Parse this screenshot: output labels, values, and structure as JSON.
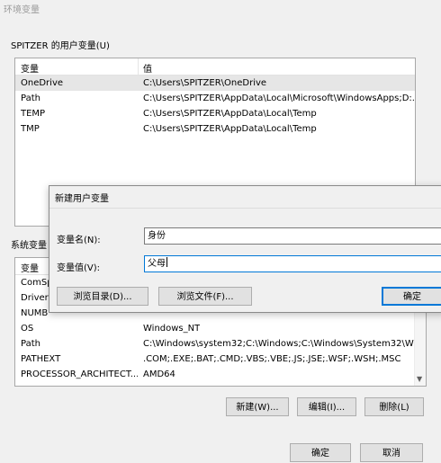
{
  "window": {
    "title": "环境变量"
  },
  "user_vars": {
    "group_label": "SPITZER 的用户变量(U)",
    "col_name": "变量",
    "col_value": "值",
    "rows": [
      {
        "name": "OneDrive",
        "value": "C:\\Users\\SPITZER\\OneDrive"
      },
      {
        "name": "Path",
        "value": "C:\\Users\\SPITZER\\AppData\\Local\\Microsoft\\WindowsApps;D:..."
      },
      {
        "name": "TEMP",
        "value": "C:\\Users\\SPITZER\\AppData\\Local\\Temp"
      },
      {
        "name": "TMP",
        "value": "C:\\Users\\SPITZER\\AppData\\Local\\Temp"
      }
    ]
  },
  "system_vars": {
    "group_label": "系统变量",
    "col_name": "变量",
    "rows": [
      {
        "name": "ComSp",
        "value": ""
      },
      {
        "name": "DriverI",
        "value": ""
      },
      {
        "name": "NUMB",
        "value": ""
      },
      {
        "name": "OS",
        "value": "Windows_NT"
      },
      {
        "name": "Path",
        "value": "C:\\Windows\\system32;C:\\Windows;C:\\Windows\\System32\\Wb..."
      },
      {
        "name": "PATHEXT",
        "value": ".COM;.EXE;.BAT;.CMD;.VBS;.VBE;.JS;.JSE;.WSF;.WSH;.MSC"
      },
      {
        "name": "PROCESSOR_ARCHITECT...",
        "value": "AMD64"
      }
    ],
    "buttons": {
      "new": "新建(W)...",
      "edit": "编辑(I)...",
      "delete": "删除(L)"
    }
  },
  "footer": {
    "ok": "确定",
    "cancel": "取消"
  },
  "dialog": {
    "title": "新建用户变量",
    "name_label": "变量名(N):",
    "name_value": "身份",
    "value_label": "变量值(V):",
    "value_value": "父母",
    "browse_dir": "浏览目录(D)...",
    "browse_file": "浏览文件(F)...",
    "ok": "确定"
  }
}
